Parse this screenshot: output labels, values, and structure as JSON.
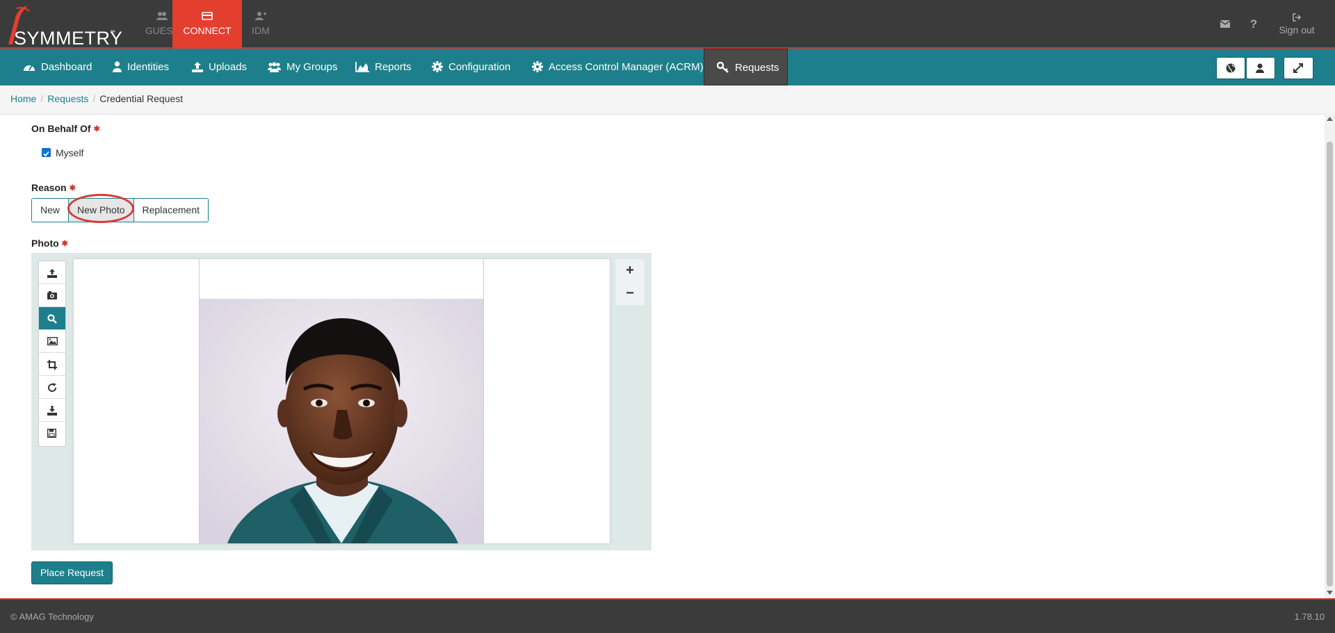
{
  "brand": {
    "name": "SYMMETRY",
    "tm": "™"
  },
  "app_tabs": [
    {
      "label": "GUEST",
      "icon": "users-icon"
    },
    {
      "label": "CONNECT",
      "icon": "credit-card-icon",
      "active": true
    },
    {
      "label": "IDM",
      "icon": "user-plus-icon"
    }
  ],
  "top_right": {
    "mail_icon": "envelope-icon",
    "help_icon": "question-icon",
    "signout_label": "Sign out"
  },
  "nav": [
    {
      "label": "Dashboard",
      "icon": "dashboard-icon"
    },
    {
      "label": "Identities",
      "icon": "user-icon"
    },
    {
      "label": "Uploads",
      "icon": "upload-icon"
    },
    {
      "label": "My Groups",
      "icon": "users-icon"
    },
    {
      "label": "Reports",
      "icon": "area-chart-icon"
    },
    {
      "label": "Configuration",
      "icon": "gear-icon"
    },
    {
      "label": "Access Control Manager (ACRM)",
      "icon": "gear-icon"
    },
    {
      "label": "Requests",
      "icon": "key-icon",
      "active": true
    }
  ],
  "breadcrumb": [
    "Home",
    "Requests",
    "Credential Request"
  ],
  "form": {
    "on_behalf_label": "On Behalf Of",
    "myself_label": "Myself",
    "myself_checked": true,
    "reason_label": "Reason",
    "reason_options": [
      "New",
      "New Photo",
      "Replacement"
    ],
    "reason_selected": "New Photo",
    "photo_label": "Photo",
    "zoom_in": "+",
    "zoom_out": "−",
    "submit_label": "Place Request"
  },
  "photo_tools": [
    "upload-icon",
    "camera-icon",
    "search-icon",
    "image-icon",
    "crop-icon",
    "rotate-icon",
    "download-icon",
    "save-icon"
  ],
  "footer": {
    "copyright": "© AMAG Technology",
    "version": "1.78.10"
  },
  "colors": {
    "brand_red": "#e43e2f",
    "teal": "#1e7f8c",
    "dark": "#3b3b3b"
  }
}
